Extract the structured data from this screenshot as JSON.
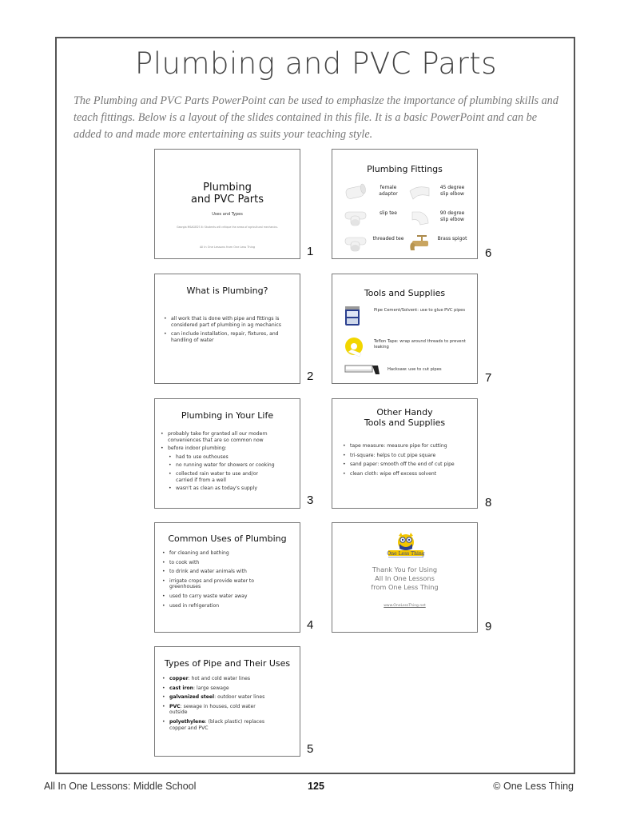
{
  "page": {
    "title": "Plumbing and PVC Parts",
    "intro": "The Plumbing and PVC Parts PowerPoint can be used to emphasize the importance of plumbing skills and teach fittings. Below is a layout of the slides contained in this file. It is a basic PowerPoint and can be added to and made more entertaining as suits your teaching style."
  },
  "slides": {
    "s1": {
      "number": "1",
      "title_line1": "Plumbing",
      "title_line2": "and PVC Parts",
      "subtitle": "Uses and Types",
      "standard": "Georgia MSAGED7-6: Students will critique the areas of agricultural mechanics.",
      "footer": "All In One Lessons from One Less Thing"
    },
    "s2": {
      "number": "2",
      "title": "What is Plumbing?",
      "bullets": [
        "all work that is done with pipe and fittings is considered part of plumbing in ag mechanics",
        "can include installation, repair, fixtures, and handling of water"
      ]
    },
    "s3": {
      "number": "3",
      "title": "Plumbing in Your Life",
      "bullets": [
        "probably take for granted all our modern conveniences that are so common now",
        "before indoor plumbing:"
      ],
      "sub_bullets": [
        "had to use outhouses",
        "no running water for showers or cooking",
        "collected rain water to use and/or carried if from a well",
        "wasn't as clean as today's supply"
      ]
    },
    "s4": {
      "number": "4",
      "title": "Common Uses of Plumbing",
      "bullets": [
        "for cleaning and bathing",
        "to cook with",
        "to drink and water animals with",
        "irrigate crops and provide water to greenhouses",
        "used to carry waste water away",
        "used in refrigeration"
      ]
    },
    "s5": {
      "number": "5",
      "title": "Types of Pipe and Their Uses",
      "items": [
        {
          "term": "copper",
          "desc": ": hot and cold water lines"
        },
        {
          "term": "cast iron",
          "desc": ": large sewage"
        },
        {
          "term": "galvanized steel",
          "desc": ": outdoor water lines"
        },
        {
          "term": "PVC",
          "desc": ": sewage in houses, cold water outside"
        },
        {
          "term": "polyethylene",
          "desc": ": (black plastic) replaces copper and PVC"
        }
      ]
    },
    "s6": {
      "number": "6",
      "title": "Plumbing Fittings",
      "fittings": [
        {
          "label": "female adaptor",
          "icon": "female-adaptor-icon"
        },
        {
          "label": "45 degree slip elbow",
          "icon": "45-degree-elbow-icon"
        },
        {
          "label": "slip tee",
          "icon": "slip-tee-icon"
        },
        {
          "label": "90 degree slip elbow",
          "icon": "90-degree-elbow-icon"
        },
        {
          "label": "threaded tee",
          "icon": "threaded-tee-icon"
        },
        {
          "label": "Brass spigot",
          "icon": "brass-spigot-icon"
        }
      ]
    },
    "s7": {
      "number": "7",
      "title": "Tools and Supplies",
      "tools": [
        {
          "label": "Pipe Cement/Solvent:  use to glue PVC pipes",
          "icon": "pipe-cement-can-icon"
        },
        {
          "label": "Teflon Tape:  wrap around threads to prevent leaking",
          "icon": "teflon-tape-icon"
        },
        {
          "label": "Hacksaw: use to cut pipes",
          "icon": "hacksaw-icon"
        }
      ]
    },
    "s8": {
      "number": "8",
      "title_line1": "Other Handy",
      "title_line2": "Tools and Supplies",
      "bullets": [
        "tape measure: measure pipe for cutting",
        "tri-square: helps to cut pipe square",
        "sand paper: smooth off the end of cut pipe",
        "clean cloth: wipe off excess solvent"
      ]
    },
    "s9": {
      "number": "9",
      "logo_text": "One Less Thing",
      "text_line1": "Thank You for Using",
      "text_line2": "All In One Lessons",
      "text_line3": "from One Less Thing",
      "link": "www.OneLessThing.net"
    }
  },
  "footer": {
    "left": "All In One Lessons: Middle School",
    "page_number": "125",
    "right": "© One Less Thing"
  },
  "colors": {
    "frame": "#555555",
    "title": "#444444",
    "intro": "#777777",
    "logo_yellow": "#f2c500",
    "logo_blue": "#2a3f8f"
  }
}
